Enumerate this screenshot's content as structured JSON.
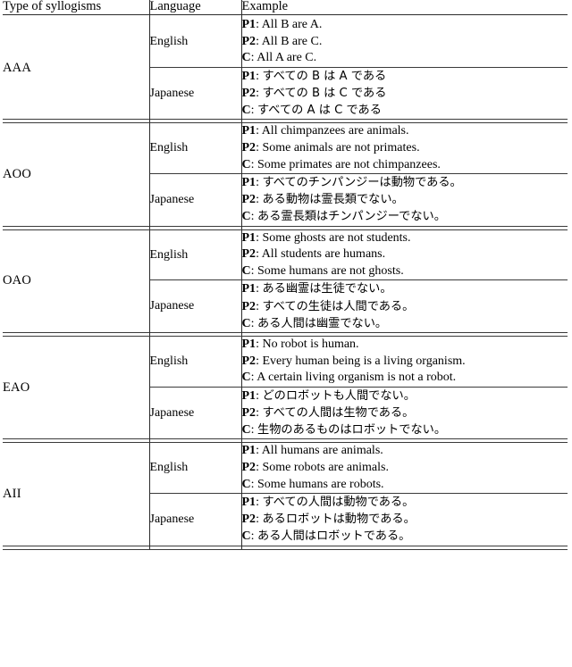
{
  "table": {
    "headers": {
      "type": "Type of syllogisms",
      "language": "Language",
      "example": "Example"
    },
    "labels": {
      "p1": "P1",
      "p2": "P2",
      "c": "C",
      "colon": ": ",
      "english": "English",
      "japanese": "Japanese"
    },
    "sections": [
      {
        "type": "AAA",
        "english": {
          "language": "English",
          "p1": "All B are A.",
          "p2": "All B are C.",
          "c": "All A are C."
        },
        "japanese": {
          "language": "Japanese",
          "p1": "すべての B は A である",
          "p2": "すべての B は C である",
          "c": "すべての A は C である"
        }
      },
      {
        "type": "AOO",
        "english": {
          "language": "English",
          "p1": "All chimpanzees are animals.",
          "p2": "Some animals are not primates.",
          "c": "Some primates are not chimpanzees."
        },
        "japanese": {
          "language": "Japanese",
          "p1": "すべてのチンパンジーは動物である。",
          "p2": "ある動物は霊長類でない。",
          "c": "ある霊長類はチンパンジーでない。"
        }
      },
      {
        "type": "OAO",
        "english": {
          "language": "English",
          "p1": "Some ghosts are not students.",
          "p2": "All students are humans.",
          "c": "Some humans are not ghosts."
        },
        "japanese": {
          "language": "Japanese",
          "p1": "ある幽霊は生徒でない。",
          "p2": "すべての生徒は人間である。",
          "c": "ある人間は幽霊でない。"
        }
      },
      {
        "type": "EAO",
        "english": {
          "language": "English",
          "p1": "No robot is human.",
          "p2": "Every human being is a living organism.",
          "c": "A certain living organism is not a robot."
        },
        "japanese": {
          "language": "Japanese",
          "p1": "どのロボットも人間でない。",
          "p2": "すべての人間は生物である。",
          "c": "生物のあるものはロボットでない。"
        }
      },
      {
        "type": "AII",
        "english": {
          "language": "English",
          "p1": "All humans are animals.",
          "p2": "Some robots are animals.",
          "c": "Some humans are robots."
        },
        "japanese": {
          "language": "Japanese",
          "p1": "すべての人間は動物である。",
          "p2": "あるロボットは動物である。",
          "c": "ある人間はロボットである。"
        }
      }
    ]
  }
}
